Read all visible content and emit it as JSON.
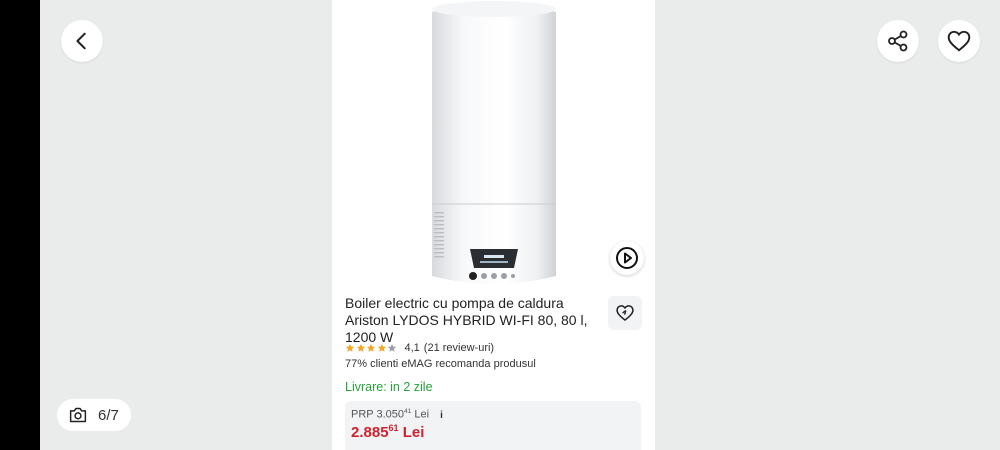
{
  "overlay": {
    "counter": "6/7",
    "icons": {
      "back": "chevron-left-icon",
      "share": "share-icon",
      "favorite": "heart-icon",
      "gallery": "camera-icon"
    }
  },
  "product": {
    "title": "Boiler electric cu pompa de caldura Ariston LYDOS HYBRID WI-FI 80, 80 l, 1200 W",
    "gallery": {
      "slides": 5,
      "active": 1
    },
    "rating": {
      "value": 4.1,
      "stars_filled": 4,
      "score_text": "4,1",
      "reviews_text": "(21 review-uri)"
    },
    "recommend_text": "77% clienti eMAG recomanda produsul",
    "delivery_text": "Livrare: in 2 zile",
    "price": {
      "rrp_label": "PRP 3.050",
      "rrp_decimals": "41",
      "rrp_currency": "Lei",
      "current_int": "2.885",
      "current_decimals": "61",
      "current_currency": "Lei"
    }
  },
  "colors": {
    "delivery": "#27a139",
    "price": "#d0222e",
    "star": "#f5a623",
    "background": "#e9eceb"
  }
}
